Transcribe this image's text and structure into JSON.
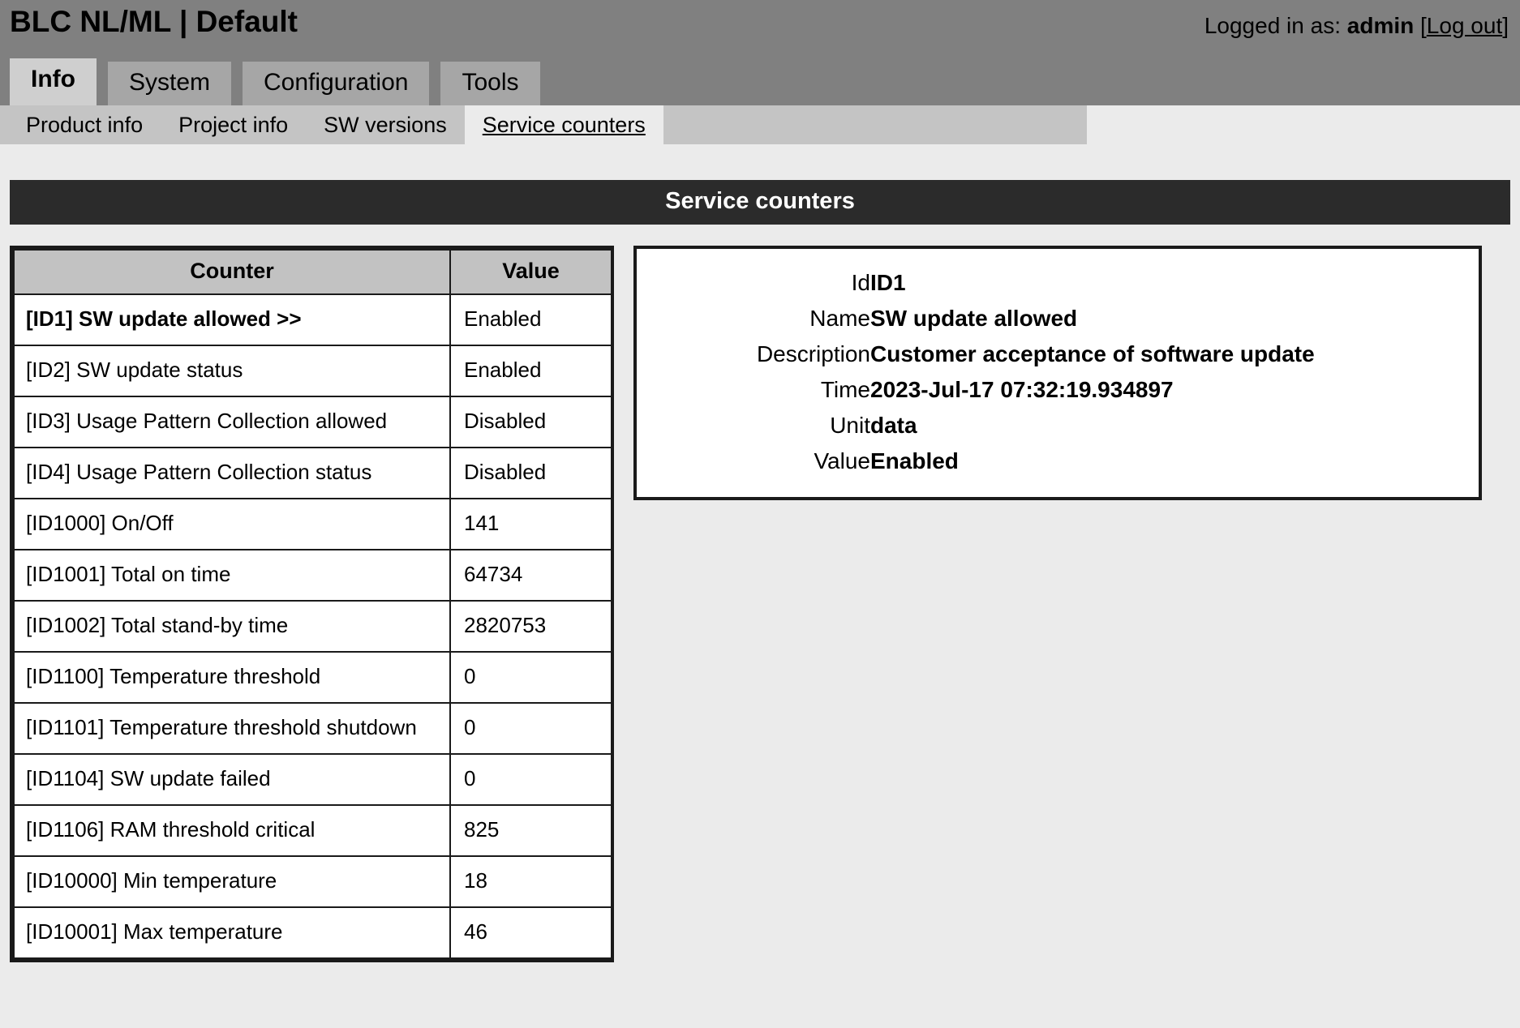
{
  "header": {
    "app_title": "BLC NL/ML | Default",
    "logged_in_prefix": "Logged in as:",
    "username": "admin",
    "bracket_open": "[",
    "logout_label": "Log out",
    "bracket_close": "]"
  },
  "tabs": [
    {
      "label": "Info",
      "active": true
    },
    {
      "label": "System",
      "active": false
    },
    {
      "label": "Configuration",
      "active": false
    },
    {
      "label": "Tools",
      "active": false
    }
  ],
  "subnav": [
    {
      "label": "Product info",
      "active": false
    },
    {
      "label": "Project info",
      "active": false
    },
    {
      "label": "SW versions",
      "active": false
    },
    {
      "label": "Service counters",
      "active": true
    }
  ],
  "page": {
    "title": "Service counters"
  },
  "table": {
    "columns": [
      "Counter",
      "Value"
    ],
    "rows": [
      {
        "name": "[ID1] SW update allowed >>",
        "value": "Enabled",
        "selected": true
      },
      {
        "name": "[ID2] SW update status",
        "value": "Enabled",
        "selected": false
      },
      {
        "name": "[ID3] Usage Pattern Collection allowed",
        "value": "Disabled",
        "selected": false
      },
      {
        "name": "[ID4] Usage Pattern Collection status",
        "value": "Disabled",
        "selected": false
      },
      {
        "name": "[ID1000] On/Off",
        "value": "141",
        "selected": false
      },
      {
        "name": "[ID1001] Total on time",
        "value": "64734",
        "selected": false
      },
      {
        "name": "[ID1002] Total stand-by time",
        "value": "2820753",
        "selected": false
      },
      {
        "name": "[ID1100] Temperature threshold",
        "value": "0",
        "selected": false
      },
      {
        "name": "[ID1101] Temperature threshold shutdown",
        "value": "0",
        "selected": false
      },
      {
        "name": "[ID1104] SW update failed",
        "value": "0",
        "selected": false
      },
      {
        "name": "[ID1106] RAM threshold critical",
        "value": "825",
        "selected": false
      },
      {
        "name": "[ID10000] Min temperature",
        "value": "18",
        "selected": false
      },
      {
        "name": "[ID10001] Max temperature",
        "value": "46",
        "selected": false
      }
    ]
  },
  "detail": {
    "fields": [
      {
        "label": "Id",
        "value": "ID1"
      },
      {
        "label": "Name",
        "value": "SW update allowed"
      },
      {
        "label": "Description",
        "value": "Customer acceptance of software update"
      },
      {
        "label": "Time",
        "value": "2023-Jul-17 07:32:19.934897"
      },
      {
        "label": "Unit",
        "value": "data"
      },
      {
        "label": "Value",
        "value": "Enabled"
      }
    ]
  },
  "colors": {
    "topbar": "#808080",
    "tab_active": "#cfcfcf",
    "tab_inactive": "#a6a6a6",
    "subnav": "#c4c4c4",
    "page_header_bg": "#2b2b2b",
    "page_bg": "#ebebeb",
    "table_header_bg": "#c2c2c2",
    "border": "#1a1a1a"
  }
}
